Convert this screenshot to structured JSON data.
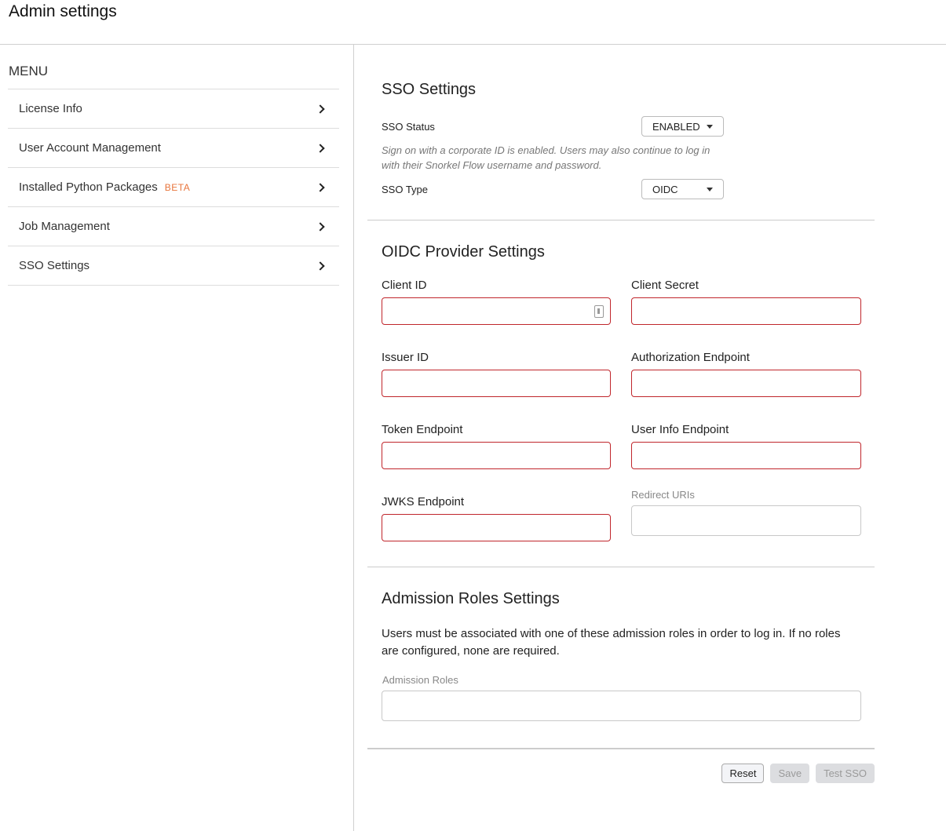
{
  "header": {
    "title": "Admin settings"
  },
  "sidebar": {
    "title": "MENU",
    "items": [
      {
        "label": "License Info"
      },
      {
        "label": "User Account Management"
      },
      {
        "label": "Installed Python Packages",
        "badge": "BETA"
      },
      {
        "label": "Job Management"
      },
      {
        "label": "SSO Settings"
      }
    ]
  },
  "sso": {
    "title": "SSO Settings",
    "status_label": "SSO Status",
    "status_value": "ENABLED",
    "note": "Sign on with a corporate ID is enabled. Users may also continue to log in with their Snorkel Flow username and password.",
    "type_label": "SSO Type",
    "type_value": "OIDC"
  },
  "oidc": {
    "title": "OIDC Provider Settings",
    "fields": [
      {
        "label": "Client ID",
        "value": ""
      },
      {
        "label": "Client Secret",
        "value": ""
      },
      {
        "label": "Issuer ID",
        "value": ""
      },
      {
        "label": "Authorization Endpoint",
        "value": ""
      },
      {
        "label": "Token Endpoint",
        "value": ""
      },
      {
        "label": "User Info Endpoint",
        "value": ""
      },
      {
        "label": "JWKS Endpoint",
        "value": ""
      }
    ],
    "redirect_label": "Redirect URIs"
  },
  "admission": {
    "title": "Admission Roles Settings",
    "description": "Users must be associated with one of these admission roles in order to log in. If no roles are configured, none are required.",
    "roles_label": "Admission Roles"
  },
  "actions": {
    "reset": "Reset",
    "save": "Save",
    "test": "Test SSO"
  },
  "colors": {
    "error_border": "#c0262c",
    "beta": "#e8743b"
  }
}
